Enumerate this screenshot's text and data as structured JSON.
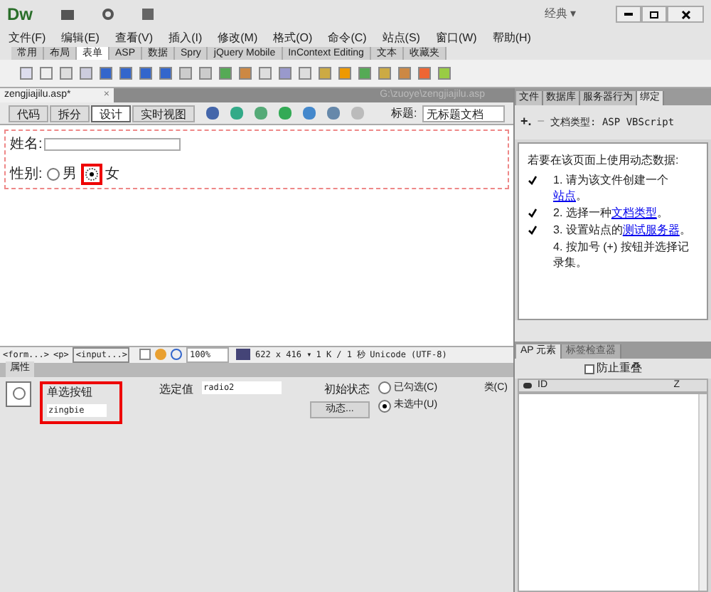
{
  "app": {
    "logo": "Dw",
    "workspace": "经典 ▾"
  },
  "menu": [
    "文件(F)",
    "编辑(E)",
    "查看(V)",
    "插入(I)",
    "修改(M)",
    "格式(O)",
    "命令(C)",
    "站点(S)",
    "窗口(W)",
    "帮助(H)"
  ],
  "insert_tabs": [
    {
      "label": "常用",
      "selected": false
    },
    {
      "label": "布局",
      "selected": false
    },
    {
      "label": "表单",
      "selected": true
    },
    {
      "label": "ASP",
      "selected": false
    },
    {
      "label": "数据",
      "selected": false
    },
    {
      "label": "Spry",
      "selected": false
    },
    {
      "label": "jQuery Mobile",
      "selected": false
    },
    {
      "label": "InContext Editing",
      "selected": false
    },
    {
      "label": "文本",
      "selected": false
    },
    {
      "label": "收藏夹",
      "selected": false
    }
  ],
  "document": {
    "tab": "zengjiajilu.asp*",
    "close": "×",
    "path": "G:\\zuoye\\zengjiajilu.asp",
    "views": [
      {
        "label": "代码",
        "selected": false
      },
      {
        "label": "拆分",
        "selected": false
      },
      {
        "label": "设计",
        "selected": true
      },
      {
        "label": "实时视图",
        "selected": false
      }
    ],
    "title_label": "标题:",
    "title_value": "无标题文档",
    "name_label": "姓名:",
    "gender_label": "性别:",
    "radios": [
      {
        "label": "男",
        "selected": false
      },
      {
        "label": "女",
        "selected": true
      }
    ]
  },
  "tag_bar": {
    "tags": [
      "<form...>",
      "<p>",
      "<input...>"
    ],
    "zoom": "100%",
    "size": "622 x 416 ▾",
    "download": "1 K / 1 秒",
    "encoding": "Unicode (UTF-8)"
  },
  "properties": {
    "title": "属性",
    "type": "单选按钮",
    "name": "zingbie",
    "value_label": "选定值",
    "value": "radio2",
    "initial_label": "初始状态",
    "dynamic": "动态...",
    "class_label": "类(C)",
    "initial_options": [
      {
        "label": "已勾选(C)",
        "selected": false
      },
      {
        "label": "未选中(U)",
        "selected": true
      }
    ]
  },
  "right_panel": {
    "tabs": [
      {
        "label": "文件",
        "selected": false
      },
      {
        "label": "数据库",
        "selected": false
      },
      {
        "label": "服务器行为",
        "selected": false
      },
      {
        "label": "绑定",
        "selected": true
      }
    ],
    "plus": "+.",
    "minus": "−",
    "doc_type": "文档类型: ASP VBScript",
    "intro": "若要在该页面上使用动态数据:",
    "steps": [
      {
        "done": true,
        "text": "1. 请为该文件创建一个",
        "link": "站点",
        "end": "。"
      },
      {
        "done": true,
        "text": "2. 选择一种",
        "link": "文档类型",
        "end": "。"
      },
      {
        "done": true,
        "text": "3. 设置站点的",
        "link": "测试服务器",
        "end": "。"
      },
      {
        "done": false,
        "text": "4. 按加号 (+) 按钮并选择记录集。"
      }
    ]
  },
  "ap_panel": {
    "tabs": [
      {
        "label": "AP 元素",
        "selected": true
      },
      {
        "label": "标签检查器",
        "selected": false
      }
    ],
    "prevent_overlap": {
      "label": "防止重叠",
      "checked": false
    },
    "columns": [
      "ID",
      "Z"
    ]
  }
}
